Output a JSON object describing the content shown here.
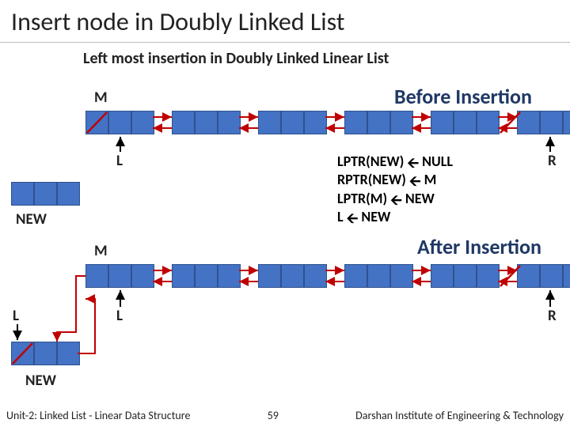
{
  "title": "Insert node in Doubly Linked List",
  "subtitle": "Left most insertion in Doubly Linked Linear List",
  "labels": {
    "M1": "M",
    "L1": "L",
    "NEW1": "NEW",
    "R1": "R",
    "before": "Before Insertion",
    "M2": "M",
    "L2a": "L",
    "L2b": "L",
    "NEW2": "NEW",
    "R2": "R",
    "after": "After Insertion"
  },
  "steps": {
    "s1a": "LPTR(NEW)",
    "s1b": "NULL",
    "s2a": "RPTR(NEW)",
    "s2b": "M",
    "s3a": "LPTR(M)",
    "s3b": "NEW",
    "s4a": "L",
    "s4b": "NEW"
  },
  "footer": {
    "left": "Unit-2: Linked List - Linear Data Structure",
    "center": "59",
    "right": "Darshan Institute of Engineering & Technology"
  }
}
